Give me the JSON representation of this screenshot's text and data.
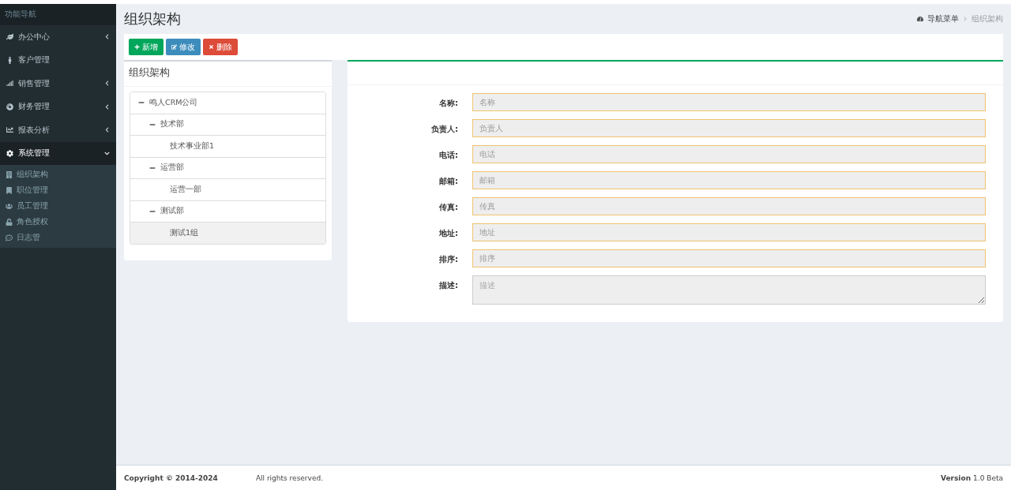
{
  "sidebar": {
    "heading": "功能导航",
    "items": [
      {
        "label": "办公中心",
        "kind": "group",
        "expanded": false
      },
      {
        "label": "客户管理",
        "kind": "link"
      },
      {
        "label": "销售管理",
        "kind": "group",
        "expanded": false
      },
      {
        "label": "财务管理",
        "kind": "group",
        "expanded": false
      },
      {
        "label": "报表分析",
        "kind": "group",
        "expanded": false
      },
      {
        "label": "系统管理",
        "kind": "group",
        "expanded": true,
        "children": [
          {
            "label": "组织架构"
          },
          {
            "label": "职位管理"
          },
          {
            "label": "员工管理"
          },
          {
            "label": "角色授权"
          },
          {
            "label": "日志管"
          }
        ]
      }
    ]
  },
  "page": {
    "title": "组织架构",
    "breadcrumb": [
      "导航菜单",
      "组织架构"
    ]
  },
  "toolbar": [
    {
      "label": "新增",
      "kind": "add"
    },
    {
      "label": "修改",
      "kind": "edit"
    },
    {
      "label": "删除",
      "kind": "delete"
    }
  ],
  "tree_panel": {
    "title": "组织架构",
    "nodes": [
      {
        "label": "鸣人CRM公司",
        "expanded": true,
        "selected": false,
        "children": [
          {
            "label": "技术部",
            "expanded": true,
            "selected": false,
            "children": [
              {
                "label": "技术事业部1",
                "selected": false
              }
            ]
          },
          {
            "label": "运营部",
            "expanded": true,
            "selected": false,
            "children": [
              {
                "label": "运营一部",
                "selected": false
              }
            ]
          },
          {
            "label": "测试部",
            "expanded": true,
            "selected": false,
            "children": [
              {
                "label": "测试1组",
                "selected": true
              }
            ]
          }
        ]
      }
    ]
  },
  "form": {
    "fields": [
      {
        "label": "名称:",
        "placeholder": "名称",
        "kind": "input"
      },
      {
        "label": "负责人:",
        "placeholder": "负责人",
        "kind": "input"
      },
      {
        "label": "电话:",
        "placeholder": "电话",
        "kind": "input"
      },
      {
        "label": "邮箱:",
        "placeholder": "邮箱",
        "kind": "input"
      },
      {
        "label": "传真:",
        "placeholder": "传真",
        "kind": "input"
      },
      {
        "label": "地址:",
        "placeholder": "地址",
        "kind": "input"
      },
      {
        "label": "排序:",
        "placeholder": "排序",
        "kind": "input"
      },
      {
        "label": "描述:",
        "placeholder": "描述",
        "kind": "textarea"
      }
    ]
  },
  "footer": {
    "copyright": "Copyright © 2014-2024",
    "rights": "All rights reserved.",
    "version_label": "Version",
    "version": "1.0 Beta"
  }
}
